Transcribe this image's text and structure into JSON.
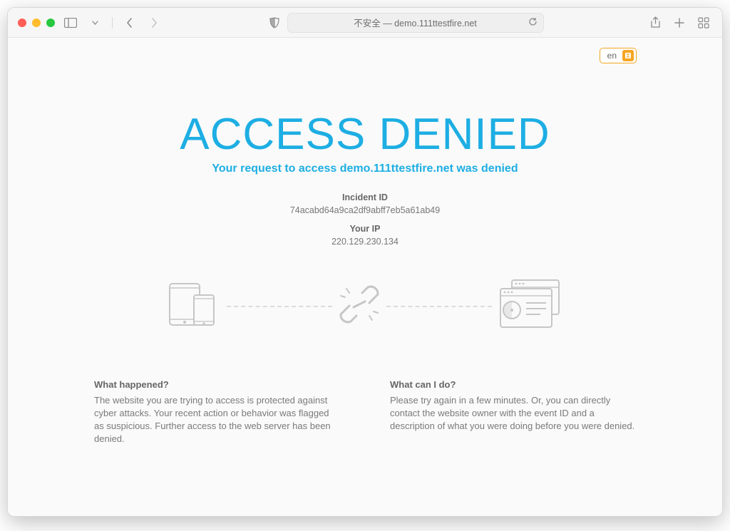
{
  "browser": {
    "addressbar_text": "不安全 — demo.111ttestfire.net"
  },
  "language": {
    "label": "en"
  },
  "page": {
    "title": "ACCESS DENIED",
    "subtitle": "Your request to access demo.111ttestfire.net was denied",
    "incident_label": "Incident ID",
    "incident_value": "74acabd64a9ca2df9abff7eb5a61ab49",
    "ip_label": "Your IP",
    "ip_value": "220.129.230.134"
  },
  "columns": {
    "left": {
      "heading": "What happened?",
      "body": "The website you are trying to access is protected against cyber attacks. Your recent action or behavior was flagged as suspicious. Further access to the web server has been denied."
    },
    "right": {
      "heading": "What can I do?",
      "body": "Please try again in a few minutes. Or, you can directly contact the website owner with the event ID and a description of what you were doing before you were denied."
    }
  }
}
